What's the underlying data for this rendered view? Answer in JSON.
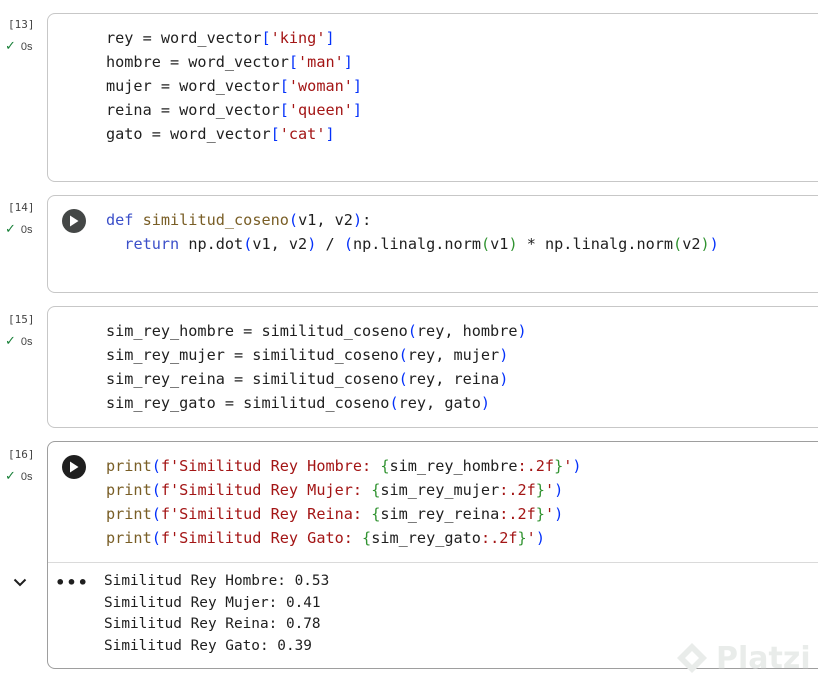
{
  "cells": [
    {
      "exec_count": "[13]",
      "status": "0s",
      "code": [
        [
          [
            "var",
            "rey = word_vector"
          ],
          [
            "pa",
            "["
          ],
          [
            "str",
            "'king'"
          ],
          [
            "pa",
            "]"
          ]
        ],
        [
          [
            "var",
            "hombre = word_vector"
          ],
          [
            "pa",
            "["
          ],
          [
            "str",
            "'man'"
          ],
          [
            "pa",
            "]"
          ]
        ],
        [
          [
            "var",
            "mujer = word_vector"
          ],
          [
            "pa",
            "["
          ],
          [
            "str",
            "'woman'"
          ],
          [
            "pa",
            "]"
          ]
        ],
        [
          [
            "var",
            "reina = word_vector"
          ],
          [
            "pa",
            "["
          ],
          [
            "str",
            "'queen'"
          ],
          [
            "pa",
            "]"
          ]
        ],
        [
          [
            "var",
            "gato = word_vector"
          ],
          [
            "pa",
            "["
          ],
          [
            "str",
            "'cat'"
          ],
          [
            "pa",
            "]"
          ]
        ]
      ]
    },
    {
      "exec_count": "[14]",
      "status": "0s",
      "code": [
        [
          [
            "kw",
            "def"
          ],
          [
            "var",
            " "
          ],
          [
            "fn",
            "similitud_coseno"
          ],
          [
            "pa",
            "("
          ],
          [
            "var",
            "v1, v2"
          ],
          [
            "pa",
            ")"
          ],
          [
            "var",
            ":"
          ]
        ],
        [
          [
            "var",
            "  "
          ],
          [
            "kw",
            "return"
          ],
          [
            "var",
            " np.dot"
          ],
          [
            "pa",
            "("
          ],
          [
            "var",
            "v1, v2"
          ],
          [
            "pa",
            ")"
          ],
          [
            "var",
            " / "
          ],
          [
            "pa",
            "("
          ],
          [
            "var",
            "np.linalg.norm"
          ],
          [
            "pb",
            "("
          ],
          [
            "var",
            "v1"
          ],
          [
            "pb",
            ")"
          ],
          [
            "var",
            " * np.linalg.norm"
          ],
          [
            "pb",
            "("
          ],
          [
            "var",
            "v2"
          ],
          [
            "pb",
            ")"
          ],
          [
            "pa",
            ")"
          ]
        ]
      ]
    },
    {
      "exec_count": "[15]",
      "status": "0s",
      "code": [
        [
          [
            "var",
            "sim_rey_hombre = similitud_coseno"
          ],
          [
            "pa",
            "("
          ],
          [
            "var",
            "rey, hombre"
          ],
          [
            "pa",
            ")"
          ]
        ],
        [
          [
            "var",
            "sim_rey_mujer = similitud_coseno"
          ],
          [
            "pa",
            "("
          ],
          [
            "var",
            "rey, mujer"
          ],
          [
            "pa",
            ")"
          ]
        ],
        [
          [
            "var",
            "sim_rey_reina = similitud_coseno"
          ],
          [
            "pa",
            "("
          ],
          [
            "var",
            "rey, reina"
          ],
          [
            "pa",
            ")"
          ]
        ],
        [
          [
            "var",
            "sim_rey_gato = similitud_coseno"
          ],
          [
            "pa",
            "("
          ],
          [
            "var",
            "rey, gato"
          ],
          [
            "pa",
            ")"
          ]
        ]
      ]
    },
    {
      "exec_count": "[16]",
      "status": "0s",
      "code": [
        [
          [
            "fn",
            "print"
          ],
          [
            "pa",
            "("
          ],
          [
            "str",
            "f'Similitud Rey Hombre: "
          ],
          [
            "pb",
            "{"
          ],
          [
            "var",
            "sim_rey_hombre"
          ],
          [
            "str",
            ":.2f"
          ],
          [
            "pb",
            "}"
          ],
          [
            "str",
            "'"
          ],
          [
            "pa",
            ")"
          ]
        ],
        [
          [
            "fn",
            "print"
          ],
          [
            "pa",
            "("
          ],
          [
            "str",
            "f'Similitud Rey Mujer: "
          ],
          [
            "pb",
            "{"
          ],
          [
            "var",
            "sim_rey_mujer"
          ],
          [
            "str",
            ":.2f"
          ],
          [
            "pb",
            "}"
          ],
          [
            "str",
            "'"
          ],
          [
            "pa",
            ")"
          ]
        ],
        [
          [
            "fn",
            "print"
          ],
          [
            "pa",
            "("
          ],
          [
            "str",
            "f'Similitud Rey Reina: "
          ],
          [
            "pb",
            "{"
          ],
          [
            "var",
            "sim_rey_reina"
          ],
          [
            "str",
            ":.2f"
          ],
          [
            "pb",
            "}"
          ],
          [
            "str",
            "'"
          ],
          [
            "pa",
            ")"
          ]
        ],
        [
          [
            "fn",
            "print"
          ],
          [
            "pa",
            "("
          ],
          [
            "str",
            "f'Similitud Rey Gato: "
          ],
          [
            "pb",
            "{"
          ],
          [
            "var",
            "sim_rey_gato"
          ],
          [
            "str",
            ":.2f"
          ],
          [
            "pb",
            "}"
          ],
          [
            "str",
            "'"
          ],
          [
            "pa",
            ")"
          ]
        ]
      ],
      "output": [
        "Similitud Rey Hombre: 0.53",
        "Similitud Rey Mujer: 0.41",
        "Similitud Rey Reina: 0.78",
        "Similitud Rey Gato: 0.39"
      ]
    }
  ],
  "icons": {
    "check": "checkmark-icon",
    "run": "play-icon",
    "collapse": "chevron-down-icon",
    "more": "more-horizontal-icon",
    "watermark_logo": "platzi-logo"
  },
  "ui": {
    "more_glyph": "•••",
    "check_glyph": "✓"
  },
  "watermark": {
    "text": "Platzi"
  },
  "colors": {
    "keyword": "#3b4fc9",
    "function": "#795e26",
    "string": "#a31515",
    "bracket_1": "#0431fa",
    "bracket_2": "#319331",
    "check": "#188038"
  }
}
